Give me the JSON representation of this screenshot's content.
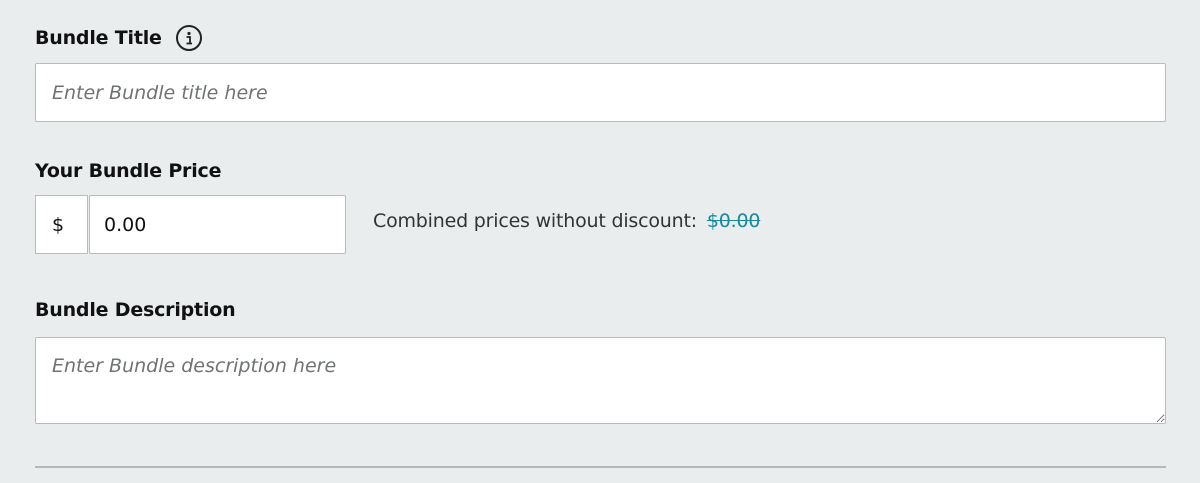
{
  "bundle_title": {
    "label": "Bundle Title",
    "info_icon": "info-icon",
    "placeholder": "Enter Bundle title here",
    "value": ""
  },
  "bundle_price": {
    "label": "Your Bundle Price",
    "currency_symbol": "$",
    "value": "0.00",
    "combined_label": "Combined prices without discount:",
    "combined_value": "$0.00",
    "combined_value_color": "#1a8a9a"
  },
  "bundle_description": {
    "label": "Bundle Description",
    "placeholder": "Enter Bundle description here",
    "value": ""
  }
}
